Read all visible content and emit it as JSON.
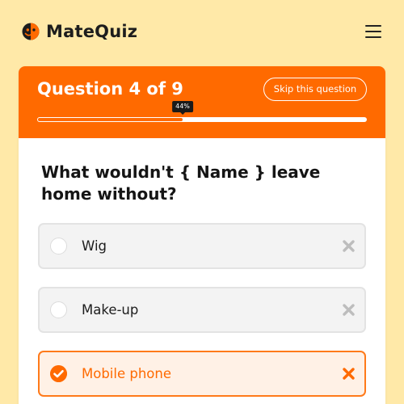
{
  "brand": {
    "name": "MateQuiz",
    "accent": "#ff6a00",
    "background": "#ffe9a8"
  },
  "header": {
    "menu_icon": "hamburger-icon"
  },
  "quiz": {
    "counter": "Question 4 of 9",
    "skip_label": "Skip this question",
    "progress": {
      "percent": 44,
      "label": "44%"
    },
    "question": "What wouldn't { Name } leave home without?",
    "options": [
      {
        "label": "Wig",
        "selected": false
      },
      {
        "label": "Make-up",
        "selected": false
      },
      {
        "label": "Mobile phone",
        "selected": true
      }
    ]
  }
}
